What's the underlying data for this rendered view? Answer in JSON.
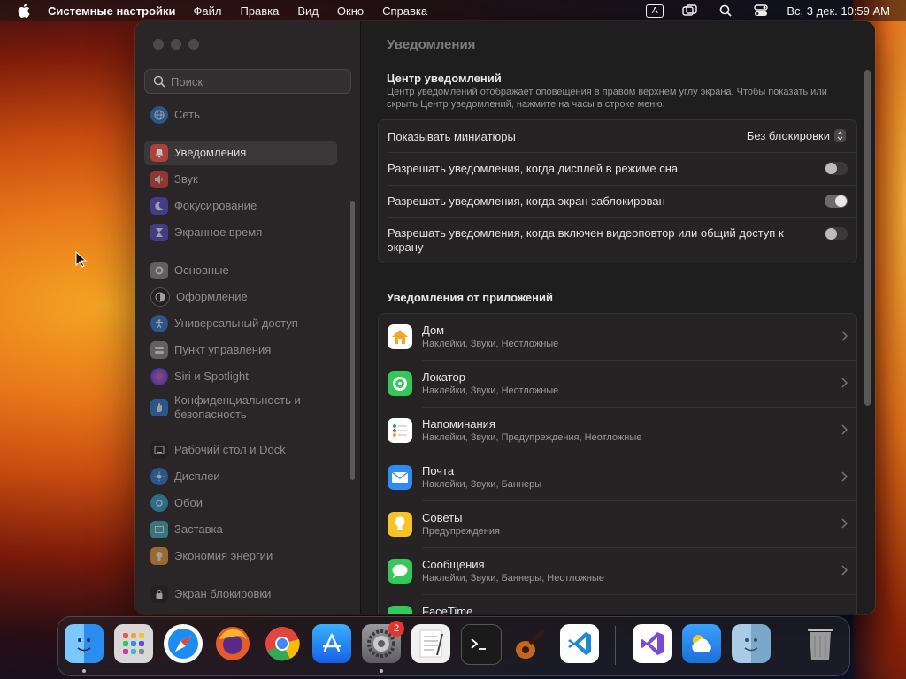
{
  "menubar": {
    "app_name": "Системные настройки",
    "menus": [
      "Файл",
      "Правка",
      "Вид",
      "Окно",
      "Справка"
    ],
    "input_indicator": "A",
    "clock": "Вс, 3 дек.  10:59 AM"
  },
  "sidebar": {
    "search_placeholder": "Поиск",
    "items": [
      {
        "label": "Сеть",
        "icon": "globe-icon",
        "color": "#2a7de1"
      },
      {
        "label": "Уведомления",
        "icon": "bell-icon",
        "color": "#e2453c",
        "selected": true
      },
      {
        "label": "Звук",
        "icon": "speaker-icon",
        "color": "#e2453c"
      },
      {
        "label": "Фокусирование",
        "icon": "moon-icon",
        "color": "#5b4fd6"
      },
      {
        "label": "Экранное время",
        "icon": "hourglass-icon",
        "color": "#5b4fd6"
      },
      {
        "label": "Основные",
        "icon": "gear-icon",
        "color": "#8e8e93"
      },
      {
        "label": "Оформление",
        "icon": "appearance-icon",
        "color": "#1c1c1e"
      },
      {
        "label": "Универсальный доступ",
        "icon": "accessibility-icon",
        "color": "#2a7de1"
      },
      {
        "label": "Пункт управления",
        "icon": "control-center-icon",
        "color": "#8e8e93"
      },
      {
        "label": "Siri и Spotlight",
        "icon": "siri-icon",
        "color": "#c03ea8"
      },
      {
        "label": "Конфиденциальность и безопасность",
        "icon": "hand-icon",
        "color": "#2a7de1"
      },
      {
        "label": "Рабочий стол и Dock",
        "icon": "dock-icon",
        "color": "#1c1c1e"
      },
      {
        "label": "Дисплеи",
        "icon": "sun-icon",
        "color": "#2a7de1"
      },
      {
        "label": "Обои",
        "icon": "wallpaper-icon",
        "color": "#2ea8d8"
      },
      {
        "label": "Заставка",
        "icon": "screensaver-icon",
        "color": "#3fb8c9"
      },
      {
        "label": "Экономия энергии",
        "icon": "bulb-icon",
        "color": "#f2a33a"
      },
      {
        "label": "Экран блокировки",
        "icon": "lock-icon",
        "color": "#1c1c1e"
      }
    ]
  },
  "main": {
    "title": "Уведомления",
    "nc_title": "Центр уведомлений",
    "nc_desc": "Центр уведомлений отображает оповещения в правом верхнем углу экрана. Чтобы показать или скрыть Центр уведомлений, нажмите на часы в строке меню.",
    "previews_label": "Показывать миниатюры",
    "previews_value": "Без блокировки",
    "toggles": [
      {
        "label": "Разрешать уведомления, когда дисплей в режиме сна",
        "on": false
      },
      {
        "label": "Разрешать уведомления, когда экран заблокирован",
        "on": true
      },
      {
        "label": "Разрешать уведомления, когда включен видеоповтор или общий доступ к экрану",
        "on": false
      }
    ],
    "apps_title": "Уведомления от приложений",
    "apps": [
      {
        "name": "Дом",
        "sub": "Наклейки, Звуки, Неотложные",
        "icon": "home-icon",
        "color": "#f5a623"
      },
      {
        "name": "Локатор",
        "sub": "Наклейки, Звуки, Неотложные",
        "icon": "findmy-icon",
        "color": "#34c759"
      },
      {
        "name": "Напоминания",
        "sub": "Наклейки, Звуки, Предупреждения, Неотложные",
        "icon": "reminders-icon",
        "color": "#ffffff"
      },
      {
        "name": "Почта",
        "sub": "Наклейки, Звуки, Баннеры",
        "icon": "mail-icon",
        "color": "#2f8cf5"
      },
      {
        "name": "Советы",
        "sub": "Предупреждения",
        "icon": "tips-icon",
        "color": "#f7c325"
      },
      {
        "name": "Сообщения",
        "sub": "Наклейки, Звуки, Баннеры, Неотложные",
        "icon": "messages-icon",
        "color": "#34c759"
      },
      {
        "name": "FaceTime",
        "sub": "",
        "icon": "facetime-icon",
        "color": "#34c759"
      }
    ]
  },
  "dock": {
    "apps": [
      {
        "name": "finder-icon",
        "color": "#3c9bf0",
        "running": true
      },
      {
        "name": "launchpad-icon",
        "color": "#d8d8d8",
        "running": false
      },
      {
        "name": "safari-icon",
        "color": "#1b8cf2",
        "running": false
      },
      {
        "name": "firefox-icon",
        "color": "#e55b2b",
        "running": false
      },
      {
        "name": "chrome-icon",
        "color": "#ffffff",
        "running": false
      },
      {
        "name": "app-store-icon",
        "color": "#1e8cf6",
        "running": false
      },
      {
        "name": "system-settings-icon",
        "color": "#8a8a8e",
        "running": true,
        "badge": "2"
      },
      {
        "name": "textedit-icon",
        "color": "#f1f1f1",
        "running": false
      },
      {
        "name": "terminal-icon",
        "color": "#1a1a1a",
        "running": false
      },
      {
        "name": "garageband-icon",
        "color": "#7a4a22",
        "running": false
      },
      {
        "name": "vscode-icon",
        "color": "#ffffff",
        "running": false
      },
      {
        "name": "visual-studio-icon",
        "color": "#ffffff",
        "running": false
      },
      {
        "name": "weather-icon",
        "color": "#2c8ae8",
        "running": false
      },
      {
        "name": "finder-folder-icon",
        "color": "#8fb9dc",
        "running": false
      },
      {
        "name": "trash-icon",
        "color": "#8b8b8b",
        "running": false
      }
    ]
  }
}
